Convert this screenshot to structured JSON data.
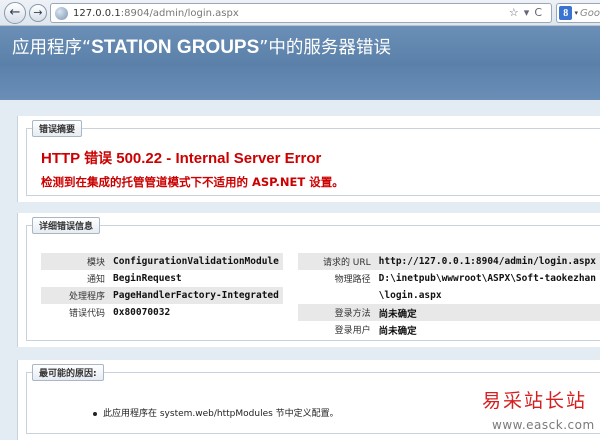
{
  "browser": {
    "url_host": "127.0.0.1",
    "url_path": ":8904/admin/login.aspx",
    "back_glyph": "←",
    "forward_glyph": "→",
    "search_hint": "Goo",
    "search_engine_glyph": "8",
    "icons": [
      "globe-icon",
      "star-icon",
      "dropdown-arrow-icon",
      "reload-icon"
    ]
  },
  "header": {
    "title_prefix": "应用程序“",
    "title_app": "STATION GROUPS",
    "title_suffix": "”中的服务器错误"
  },
  "error_summary": {
    "legend": "错误摘要",
    "title_code": "HTTP ",
    "title_zh": "错误",
    "title_rest": " 500.22 - Internal Server Error",
    "description": "检测到在集成的托管管道模式下不适用的 ASP.NET 设置。"
  },
  "details": {
    "legend": "详细错误信息",
    "left": [
      {
        "key": "模块",
        "value": "ConfigurationValidationModule"
      },
      {
        "key": "通知",
        "value": "BeginRequest"
      },
      {
        "key": "处理程序",
        "value": "PageHandlerFactory-Integrated"
      },
      {
        "key": "错误代码",
        "value": "0x80070032"
      }
    ],
    "right": [
      {
        "key": "请求的 URL",
        "value": "http://127.0.0.1:8904/admin/login.aspx"
      },
      {
        "key": "物理路径",
        "value": "D:\\inetpub\\wwwroot\\ASPX\\Soft-taokezhan",
        "value2": "\\login.aspx"
      },
      {
        "key": "登录方法",
        "value": "尚未确定"
      },
      {
        "key": "登录用户",
        "value": "尚未确定"
      }
    ]
  },
  "causes": {
    "legend": "最可能的原因:",
    "items": [
      "此应用程序在 system.web/httpModules 节中定义配置。"
    ]
  },
  "watermark": {
    "text": "易采站长站",
    "url": "www.easck.com"
  },
  "colors": {
    "header_blue": "#5a80a9",
    "error_red": "#cc0000",
    "watermark_red": "#d42020"
  }
}
